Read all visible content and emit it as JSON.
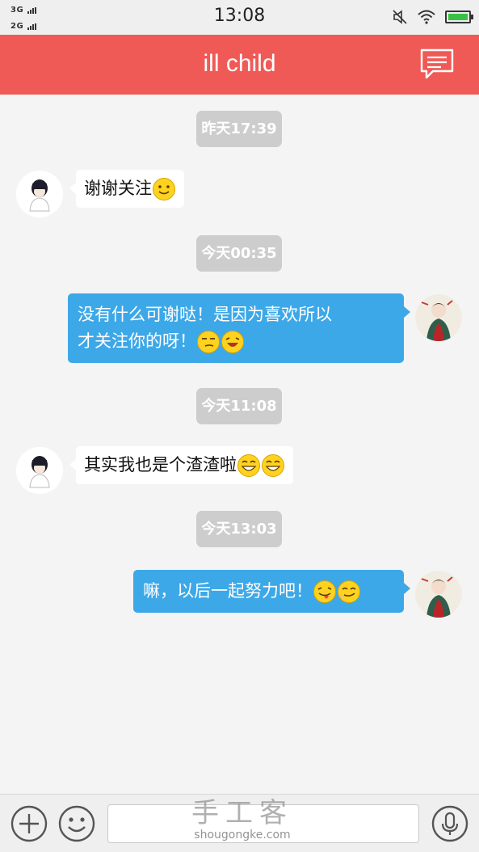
{
  "status_bar": {
    "signal_1": "3G",
    "signal_2": "2G",
    "time": "13:08",
    "battery_color": "#38c145"
  },
  "header": {
    "title": "ill child",
    "action_icon": "message-icon",
    "background": "#f05a56"
  },
  "messages": [
    {
      "type": "timestamp",
      "text": "昨天17:39"
    },
    {
      "type": "received",
      "text": "谢谢关注",
      "emoji": [
        "smile-emoji"
      ]
    },
    {
      "type": "timestamp",
      "text": "今天00:35"
    },
    {
      "type": "sent",
      "lines": [
        "没有什么可谢哒！是因为喜欢所以",
        "才关注你的呀！"
      ],
      "emoji": [
        "sly-emoji",
        "laugh-emoji"
      ]
    },
    {
      "type": "timestamp",
      "text": "今天11:08"
    },
    {
      "type": "received",
      "text": "其实我也是个渣渣啦",
      "emoji": [
        "grin-emoji",
        "grin-emoji"
      ]
    },
    {
      "type": "timestamp",
      "text": "今天13:03"
    },
    {
      "type": "sent",
      "text": "嘛，以后一起努力吧！",
      "emoji": [
        "tongue-emoji",
        "smirk-emoji"
      ]
    }
  ],
  "bottom_bar": {
    "add_icon": "plus-circle-icon",
    "emoji_icon": "smiley-icon",
    "input_value": "",
    "voice_icon": "microphone-icon"
  },
  "watermark": {
    "cn": "手工客",
    "en": "shougongke.com"
  },
  "colors": {
    "sent_bubble": "#3da8e8",
    "received_bubble": "#ffffff",
    "timestamp_bg": "#cdcdcd"
  }
}
